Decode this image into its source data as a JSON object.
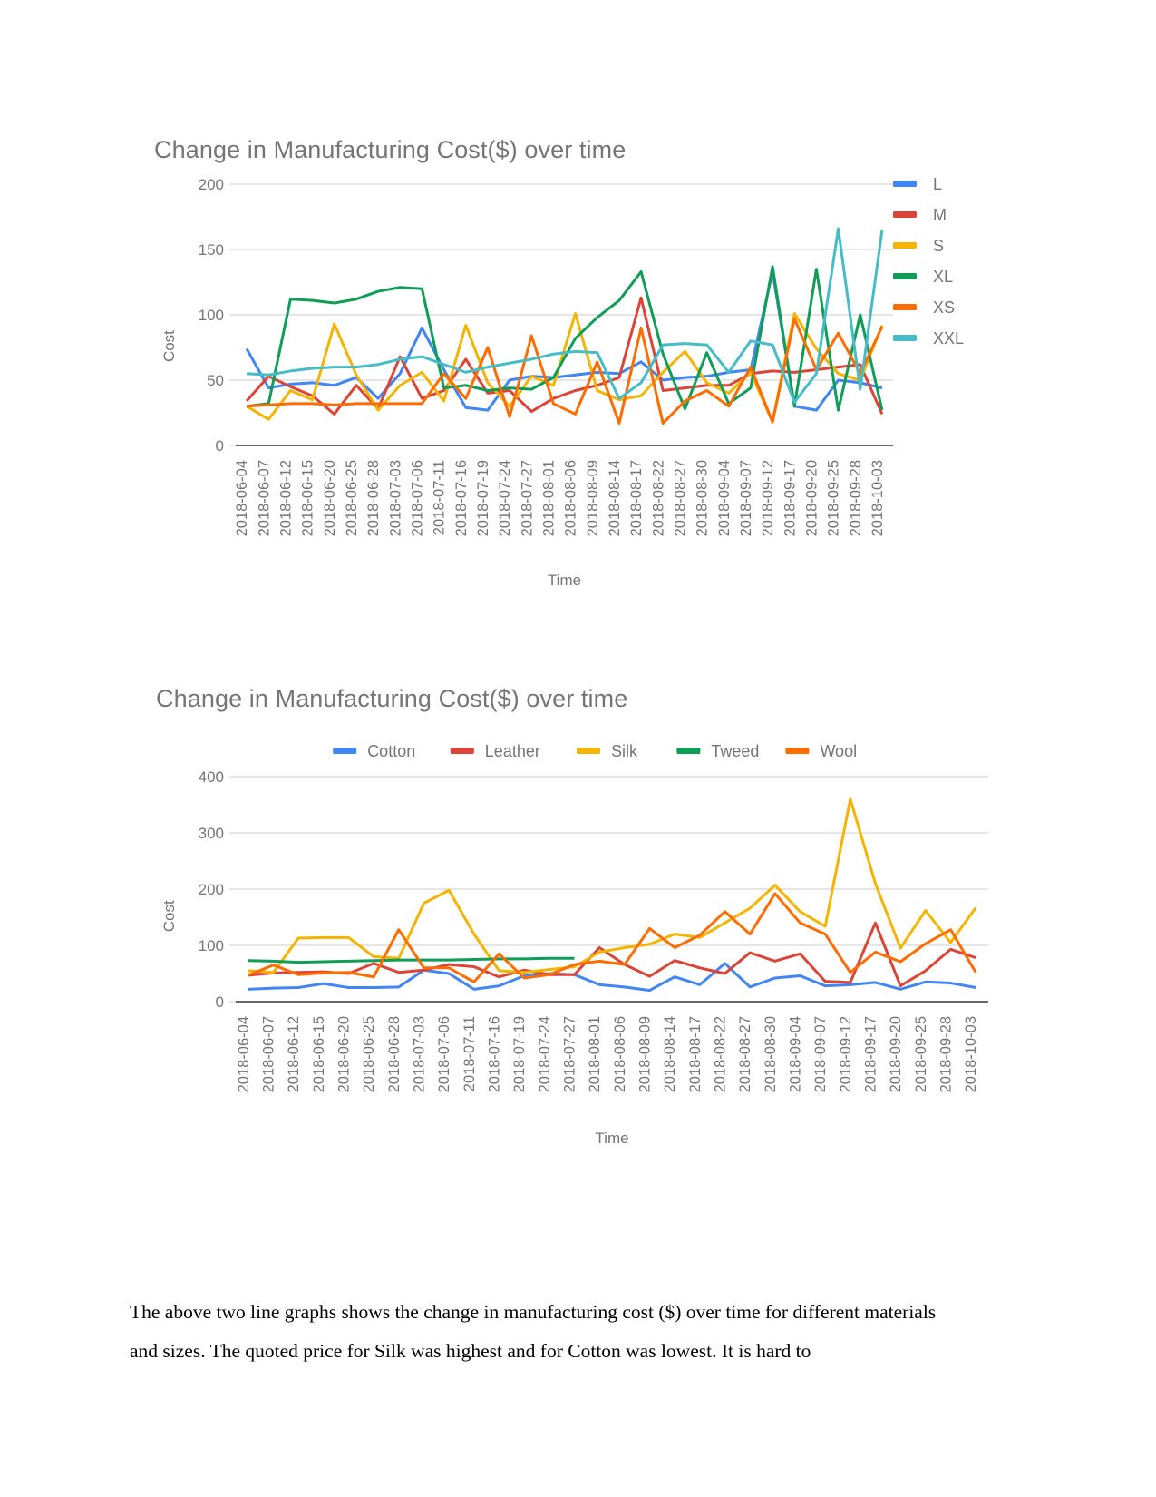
{
  "document": {
    "paragraph": "The above two line graphs shows the change in manufacturing cost ($) over time for different materials and sizes. The quoted price for Silk was highest and for Cotton was lowest. It is hard to"
  },
  "chart_data": [
    {
      "id": "sizes",
      "type": "line",
      "title": "Change in Manufacturing Cost($) over time",
      "xlabel": "Time",
      "ylabel": "Cost",
      "ylim": [
        0,
        200
      ],
      "yticks": [
        0,
        50,
        100,
        150,
        200
      ],
      "grid": true,
      "legend_position": "right",
      "colors": {
        "L": "#4285f4",
        "M": "#db4437",
        "S": "#f4b400",
        "XL": "#0f9d58",
        "XS": "#ff6d01",
        "XXL": "#46bdc6"
      },
      "categories": [
        "2018-06-04",
        "2018-06-07",
        "2018-06-12",
        "2018-06-15",
        "2018-06-20",
        "2018-06-25",
        "2018-06-28",
        "2018-07-03",
        "2018-07-06",
        "2018-07-11",
        "2018-07-16",
        "2018-07-19",
        "2018-07-24",
        "2018-07-27",
        "2018-08-01",
        "2018-08-06",
        "2018-08-09",
        "2018-08-14",
        "2018-08-17",
        "2018-08-22",
        "2018-08-27",
        "2018-08-30",
        "2018-09-04",
        "2018-09-07",
        "2018-09-12",
        "2018-09-17",
        "2018-09-20",
        "2018-09-25",
        "2018-09-28",
        "2018-10-03"
      ],
      "series": [
        {
          "name": "L",
          "values": [
            74,
            44,
            47,
            48,
            46,
            52,
            36,
            55,
            90,
            58,
            29,
            27,
            50,
            53,
            52,
            54,
            56,
            55,
            64,
            50,
            52,
            53,
            56,
            58,
            133,
            30,
            27,
            50,
            48,
            44
          ]
        },
        {
          "name": "M",
          "values": [
            34,
            53,
            45,
            38,
            24,
            46,
            28,
            68,
            36,
            42,
            66,
            40,
            42,
            26,
            36,
            42,
            46,
            52,
            113,
            42,
            44,
            46,
            46,
            55,
            57,
            56,
            58,
            60,
            62,
            24
          ]
        },
        {
          "name": "S",
          "values": [
            30,
            20,
            42,
            35,
            93,
            54,
            27,
            46,
            56,
            34,
            92,
            48,
            30,
            53,
            46,
            101,
            42,
            35,
            38,
            56,
            72,
            48,
            40,
            56,
            18,
            101,
            74,
            55,
            50,
            92
          ]
        },
        {
          "name": "XL",
          "values": [
            30,
            32,
            112,
            111,
            109,
            112,
            118,
            121,
            120,
            44,
            46,
            42,
            44,
            43,
            52,
            82,
            98,
            111,
            133,
            70,
            28,
            71,
            32,
            44,
            137,
            30,
            135,
            27,
            100,
            27
          ]
        },
        {
          "name": "XS",
          "values": [
            30,
            31,
            32,
            32,
            31,
            32,
            32,
            32,
            32,
            55,
            36,
            75,
            22,
            84,
            32,
            24,
            64,
            17,
            90,
            17,
            34,
            42,
            30,
            60,
            18,
            97,
            58,
            86,
            55,
            91
          ]
        },
        {
          "name": "XXL",
          "values": [
            55,
            54,
            57,
            59,
            60,
            60,
            62,
            66,
            68,
            62,
            56,
            60,
            63,
            66,
            70,
            72,
            71,
            36,
            48,
            77,
            78,
            77,
            56,
            80,
            77,
            33,
            55,
            166,
            43,
            165
          ]
        }
      ]
    },
    {
      "id": "materials",
      "type": "line",
      "title": "Change in Manufacturing Cost($) over time",
      "xlabel": "Time",
      "ylabel": "Cost",
      "ylim": [
        0,
        400
      ],
      "yticks": [
        0,
        100,
        200,
        300,
        400
      ],
      "grid": true,
      "legend_position": "top",
      "colors": {
        "Cotton": "#4285f4",
        "Leather": "#db4437",
        "Silk": "#f4b400",
        "Tweed": "#0f9d58",
        "Wool": "#ff6d01"
      },
      "categories": [
        "2018-06-04",
        "2018-06-07",
        "2018-06-12",
        "2018-06-15",
        "2018-06-20",
        "2018-06-25",
        "2018-06-28",
        "2018-07-03",
        "2018-07-06",
        "2018-07-11",
        "2018-07-16",
        "2018-07-19",
        "2018-07-24",
        "2018-07-27",
        "2018-08-01",
        "2018-08-06",
        "2018-08-09",
        "2018-08-14",
        "2018-08-17",
        "2018-08-22",
        "2018-08-27",
        "2018-08-30",
        "2018-09-04",
        "2018-09-07",
        "2018-09-12",
        "2018-09-17",
        "2018-09-20",
        "2018-09-25",
        "2018-09-28",
        "2018-10-03"
      ],
      "series": [
        {
          "name": "Cotton",
          "values": [
            22,
            24,
            25,
            32,
            25,
            25,
            26,
            56,
            50,
            22,
            28,
            46,
            50,
            48,
            30,
            26,
            20,
            44,
            30,
            68,
            26,
            42,
            46,
            28,
            30,
            34,
            22,
            35,
            33,
            25
          ]
        },
        {
          "name": "Leather",
          "values": [
            47,
            51,
            52,
            53,
            50,
            68,
            52,
            56,
            66,
            62,
            44,
            56,
            48,
            48,
            96,
            66,
            45,
            73,
            60,
            50,
            87,
            72,
            85,
            36,
            34,
            140,
            28,
            55,
            93,
            78
          ]
        },
        {
          "name": "Silk",
          "values": [
            55,
            52,
            113,
            114,
            114,
            80,
            77,
            175,
            198,
            120,
            55,
            52,
            57,
            62,
            88,
            96,
            102,
            120,
            114,
            140,
            166,
            207,
            160,
            134,
            360,
            210,
            95,
            162,
            105,
            167
          ]
        },
        {
          "name": "Tweed",
          "values": [
            73,
            72,
            70,
            71,
            72,
            73,
            74,
            74,
            74,
            75,
            76,
            76,
            77,
            77,
            null,
            null,
            null,
            null,
            null,
            null,
            null,
            null,
            null,
            null,
            null,
            null,
            null,
            null,
            null,
            null
          ]
        },
        {
          "name": "Wool",
          "values": [
            47,
            65,
            48,
            51,
            52,
            44,
            128,
            60,
            60,
            35,
            85,
            42,
            48,
            66,
            72,
            66,
            130,
            96,
            118,
            160,
            120,
            192,
            140,
            120,
            52,
            88,
            71,
            103,
            128,
            52
          ]
        }
      ]
    }
  ]
}
